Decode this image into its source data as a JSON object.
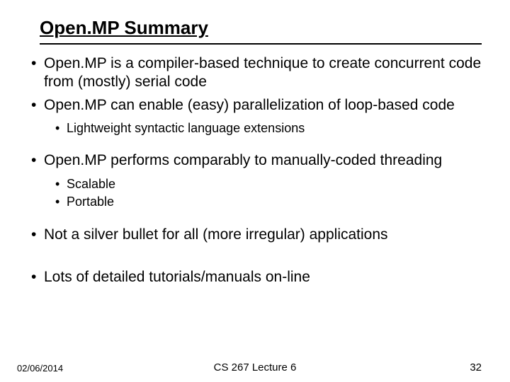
{
  "title": "Open.MP Summary",
  "bullets": [
    {
      "text": "Open.MP is a compiler-based technique to create concurrent code from (mostly) serial code",
      "sub": []
    },
    {
      "text": "Open.MP can enable (easy) parallelization of loop-based code",
      "sub": [
        "Lightweight syntactic language extensions"
      ]
    },
    {
      "text": "Open.MP performs comparably to manually-coded threading",
      "sub": [
        "Scalable",
        "Portable"
      ]
    },
    {
      "text": "Not a silver bullet for all (more irregular) applications",
      "sub": []
    },
    {
      "text": "Lots of detailed tutorials/manuals on-line",
      "sub": []
    }
  ],
  "footer": {
    "date": "02/06/2014",
    "center": "CS 267 Lecture 6",
    "page": "32"
  }
}
